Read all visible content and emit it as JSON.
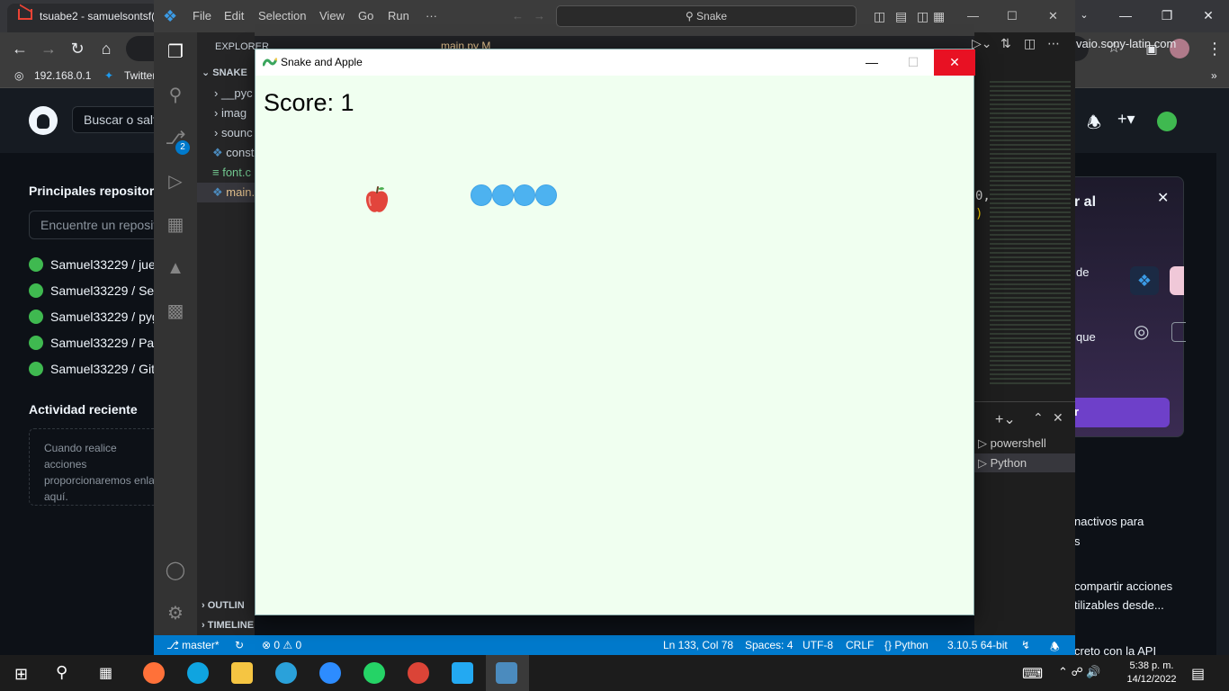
{
  "chrome": {
    "tab_title": "tsuabe2 - samuelsontsf(",
    "url": "vaio.sony-latin.com",
    "bookmarks": [
      "192.168.0.1",
      "Twitter"
    ]
  },
  "github": {
    "search_placeholder": "Buscar o salt",
    "top_repos_heading": "Principales repositorio",
    "find_repo_placeholder": "Encuentre un reposit",
    "repos": [
      "Samuel33229 / jue",
      "Samuel33229 / Ser",
      "Samuel33229 / pyg",
      "Samuel33229 / Pac",
      "Samuel33229 / Git"
    ],
    "recent_activity_heading": "Actividad reciente",
    "recent_activity_text": "Cuando realice acciones proporcionaremos enla aquí.",
    "right_card_title": "r al",
    "right_card_line1": "de",
    "right_card_line2": "que",
    "right_card_button": "r",
    "right_text_1": "nactivos para",
    "right_text_1b": "s",
    "right_text_2": "compartir acciones",
    "right_text_3": "tilizables desde...",
    "right_text_4": "creto con la API"
  },
  "vscode": {
    "menu": [
      "File",
      "Edit",
      "Selection",
      "View",
      "Go",
      "Run",
      "···"
    ],
    "search": "Snake",
    "explorer_label": "EXPLORER",
    "tab_label": "main.py M",
    "folder": "SNAKE",
    "files": [
      "__pyc",
      "imag",
      "sounc",
      "const",
      "font.c",
      "main."
    ],
    "outline": "OUTLIN",
    "timeline": "TIMELINE",
    "terminals": [
      "powershell",
      "Python"
    ],
    "code_fragment_1": "0,",
    "code_fragment_2": ")",
    "scm_badge": "2",
    "status": {
      "branch": "master*",
      "errors": "0",
      "warnings": "0",
      "position": "Ln 133, Col 78",
      "spaces": "Spaces: 4",
      "encoding": "UTF-8",
      "eol": "CRLF",
      "language": "Python",
      "interpreter": "3.10.5 64-bit"
    }
  },
  "game": {
    "window_title": "Snake and Apple",
    "score_text": "Score: 1",
    "snake_color": "#4db2f0",
    "background_color": "#f0fff0",
    "snake_segments": 4,
    "apple_icon": "apple-icon"
  },
  "taskbar": {
    "time": "5:38 p. m.",
    "date": "14/12/2022"
  }
}
